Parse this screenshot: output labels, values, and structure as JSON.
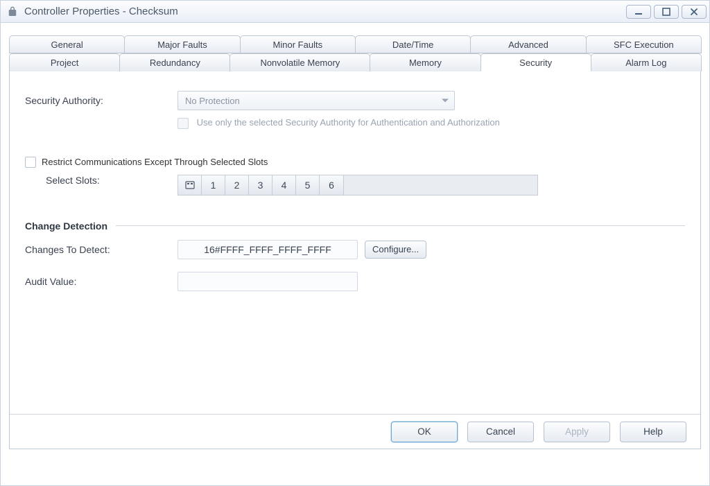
{
  "window": {
    "title": "Controller Properties - Checksum"
  },
  "tabs": {
    "row1": [
      {
        "label": "General"
      },
      {
        "label": "Major Faults"
      },
      {
        "label": "Minor Faults"
      },
      {
        "label": "Date/Time"
      },
      {
        "label": "Advanced"
      },
      {
        "label": "SFC Execution"
      }
    ],
    "row2": [
      {
        "label": "Project"
      },
      {
        "label": "Redundancy"
      },
      {
        "label": "Nonvolatile Memory"
      },
      {
        "label": "Memory"
      },
      {
        "label": "Security"
      },
      {
        "label": "Alarm Log"
      }
    ],
    "active": "Security"
  },
  "security": {
    "authority_label": "Security Authority:",
    "authority_value": "No Protection",
    "use_only_label": "Use only the selected Security Authority for Authentication and Authorization",
    "restrict_label": "Restrict Communications Except Through Selected Slots",
    "select_slots_label": "Select Slots:",
    "slots": [
      "1",
      "2",
      "3",
      "4",
      "5",
      "6"
    ]
  },
  "change_detection": {
    "header": "Change Detection",
    "changes_label": "Changes To Detect:",
    "changes_value": "16#FFFF_FFFF_FFFF_FFFF",
    "configure_label": "Configure...",
    "audit_label": "Audit Value:",
    "audit_value": ""
  },
  "buttons": {
    "ok": "OK",
    "cancel": "Cancel",
    "apply": "Apply",
    "help": "Help"
  }
}
